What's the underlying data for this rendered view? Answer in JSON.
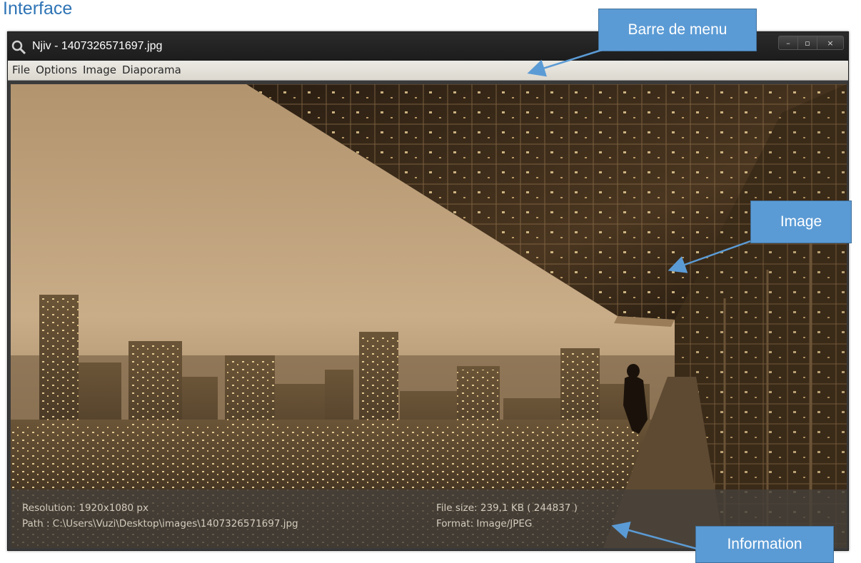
{
  "heading": "Interface",
  "window": {
    "title": "Njiv - 1407326571697.jpg",
    "app_icon": "magnifier-icon",
    "controls": {
      "minimize": "–",
      "maximize": "▫",
      "close": "×"
    }
  },
  "menu": {
    "items": [
      "File",
      "Options",
      "Image",
      "Diaporama"
    ]
  },
  "info": {
    "resolution": "Resolution: 1920x1080 px",
    "path": "Path : C:\\Users\\Vuzi\\Desktop\\images\\1407326571697.jpg",
    "file_size": "File size: 239,1 KB ( 244837 )",
    "format": "Format: Image/JPEG"
  },
  "callouts": {
    "menu_bar": "Barre de menu",
    "image": "Image",
    "information": "Information"
  },
  "colors": {
    "callout_fill": "#5b9bd5",
    "heading": "#2e74b5",
    "sepia_sky": "#c9ad88"
  }
}
